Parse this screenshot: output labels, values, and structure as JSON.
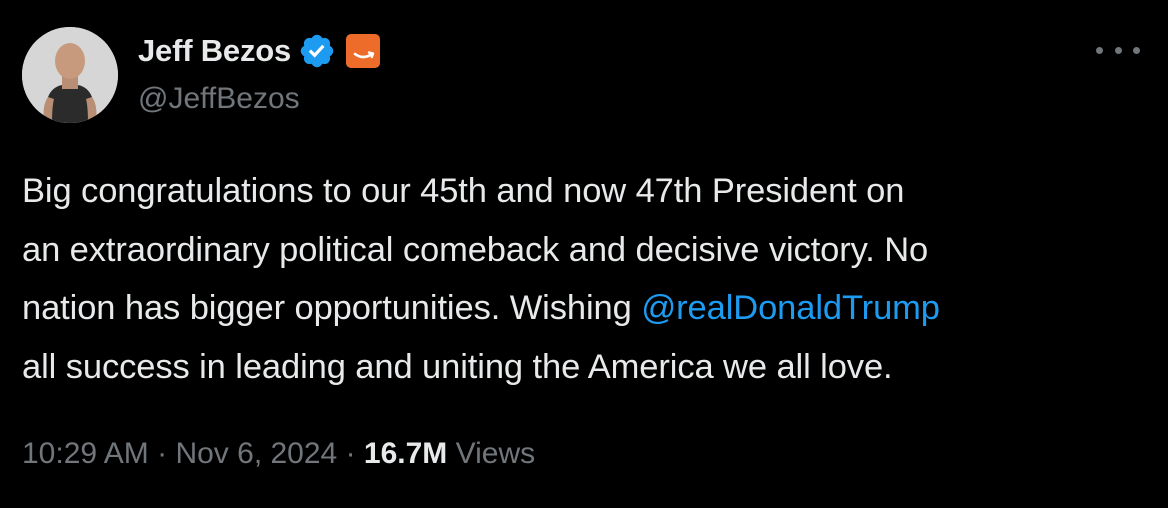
{
  "author": {
    "display_name": "Jeff Bezos",
    "handle": "@JeffBezos",
    "verified_icon": "verified-badge-icon",
    "affiliate_icon": "amazon-logo-icon"
  },
  "tweet": {
    "text_lines": [
      "Big congratulations to our 45th and now 47th President on",
      "an extraordinary political comeback and decisive victory. No",
      "nation has bigger opportunities. Wishing ",
      "all success in leading and uniting the America we all love."
    ],
    "mention": "@realDonaldTrump",
    "time": "10:29 AM",
    "separator": "·",
    "date": "Nov 6, 2024",
    "views_count": "16.7M",
    "views_label": "Views"
  },
  "colors": {
    "background": "#000000",
    "text": "#e7e9ea",
    "secondary": "#71767b",
    "link": "#1d9bf0",
    "verified": "#1d9bf0",
    "affiliate": "#ee6c2a"
  }
}
